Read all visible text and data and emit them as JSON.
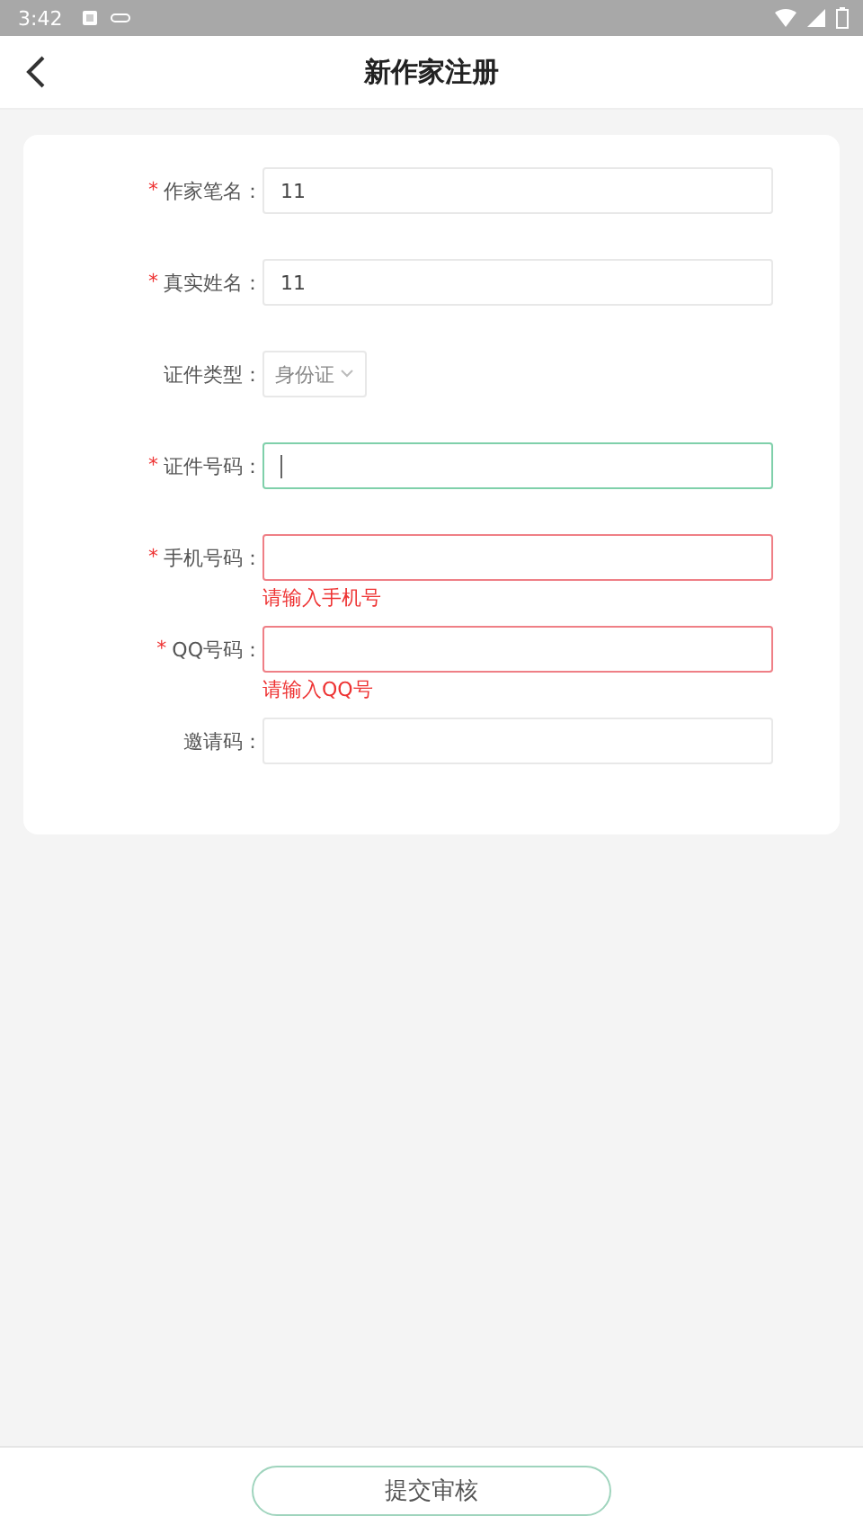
{
  "status_bar": {
    "time": "3:42"
  },
  "header": {
    "title": "新作家注册"
  },
  "form": {
    "fields": [
      {
        "label": "作家笔名：",
        "required_mark": "*",
        "kind": "text",
        "value": "11",
        "focused": false,
        "invalid": false
      },
      {
        "label": "真实姓名：",
        "required_mark": "*",
        "kind": "text",
        "value": "11",
        "focused": false,
        "invalid": false
      },
      {
        "label": "证件类型：",
        "kind": "select",
        "value": "身份证",
        "focused": false,
        "invalid": false
      },
      {
        "label": "证件号码：",
        "required_mark": "*",
        "kind": "text",
        "focused": true,
        "invalid": false
      },
      {
        "label": "手机号码：",
        "required_mark": "*",
        "kind": "text",
        "focused": false,
        "invalid": true,
        "error": "请输入手机号"
      },
      {
        "label": "QQ号码：",
        "required_mark": "*",
        "kind": "text",
        "focused": false,
        "invalid": true,
        "error": "请输入QQ号"
      },
      {
        "label": "邀请码：",
        "kind": "text",
        "focused": false,
        "invalid": false
      }
    ]
  },
  "submit_button": {
    "label": "提交审核"
  }
}
